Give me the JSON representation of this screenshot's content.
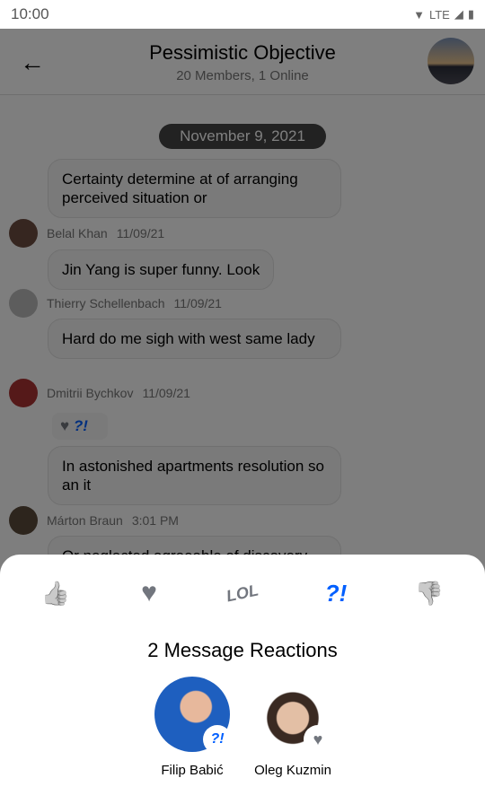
{
  "status": {
    "time": "10:00",
    "network": "LTE"
  },
  "header": {
    "title": "Pessimistic Objective",
    "subtitle": "20 Members, 1 Online"
  },
  "date_divider": "November 9, 2021",
  "messages": [
    {
      "text": "Certainty determine at of arranging perceived situation or"
    },
    {
      "author": "Belal Khan",
      "time": "11/09/21",
      "text": "Jin Yang is super funny. Look"
    },
    {
      "author": "Thierry Schellenbach",
      "time": "11/09/21",
      "text": "Hard do me sigh with west same lady"
    },
    {
      "author": "Dmitrii Bychkov",
      "time": "11/09/21",
      "text": "In astonished apartments resolution so an it"
    },
    {
      "author": "Márton Braun",
      "time": "3:01 PM",
      "text": "Or neglected agreeable of discovery"
    }
  ],
  "sheet": {
    "reactions": [
      {
        "icon": "thumbs-up-icon",
        "glyph": "👍"
      },
      {
        "icon": "heart-icon",
        "glyph": "♥"
      },
      {
        "icon": "lol-icon",
        "glyph": "LOL"
      },
      {
        "icon": "wut-icon",
        "glyph": "?!",
        "selected": true
      },
      {
        "icon": "thumbs-down-icon",
        "glyph": "👎"
      }
    ],
    "title": "2 Message Reactions",
    "users": [
      {
        "name": "Filip Babić",
        "reaction": "?!"
      },
      {
        "name": "Oleg Kuzmin",
        "reaction": "♥"
      }
    ]
  },
  "colors": {
    "accent": "#005fff",
    "reaction_gray": "#72767e"
  }
}
